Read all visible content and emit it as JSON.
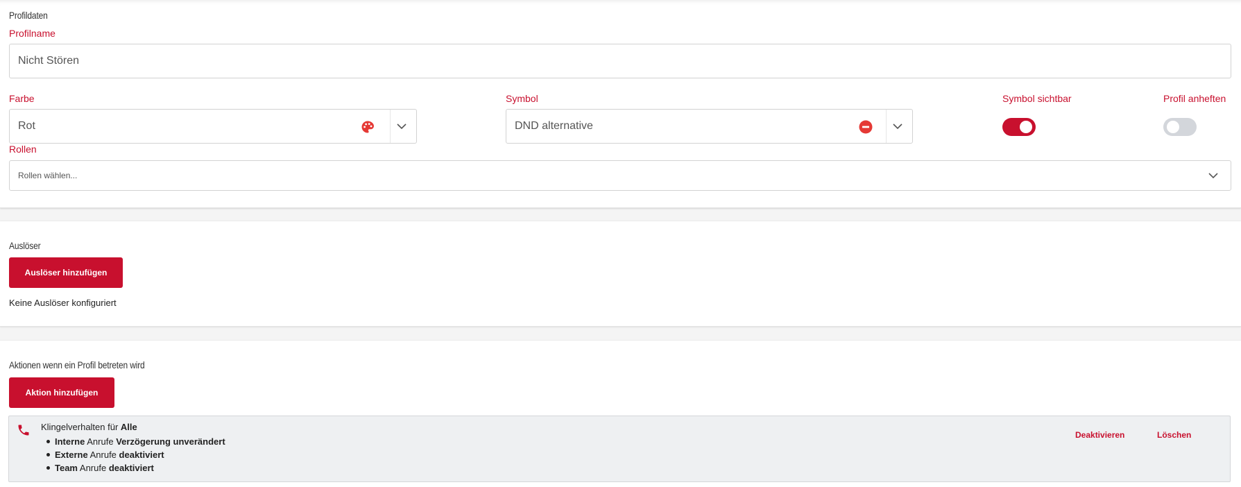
{
  "profile": {
    "section_title": "Profildaten",
    "name_label": "Profilname",
    "name_value": "Nicht Stören",
    "color_label": "Farbe",
    "color_value": "Rot",
    "symbol_label": "Symbol",
    "symbol_value": "DND alternative",
    "symbol_visible_label": "Symbol sichtbar",
    "symbol_visible_on": true,
    "pin_label": "Profil anheften",
    "pin_on": false,
    "roles_label": "Rollen",
    "roles_placeholder": "Rollen wählen..."
  },
  "triggers": {
    "section_title": "Auslöser",
    "add_button": "Auslöser hinzufügen",
    "empty_text": "Keine Auslöser konfiguriert"
  },
  "actions": {
    "section_title": "Aktionen wenn ein Profil betreten wird",
    "add_button": "Aktion hinzufügen",
    "items": [
      {
        "icon": "phone-icon",
        "headline_prefix": "Klingelverhalten für",
        "headline_target": "Alle",
        "rules": [
          {
            "type": "Interne",
            "middle": "Anrufe",
            "state": "Verzögerung unverändert"
          },
          {
            "type": "Externe",
            "middle": "Anrufe",
            "state": "deaktiviert"
          },
          {
            "type": "Team",
            "middle": "Anrufe",
            "state": "deaktiviert"
          }
        ],
        "deactivate_label": "Deaktivieren",
        "delete_label": "Löschen"
      }
    ]
  },
  "colors": {
    "accent": "#c8102e",
    "palette_icon": "#e53935",
    "toggle_off": "#d3d6db"
  }
}
